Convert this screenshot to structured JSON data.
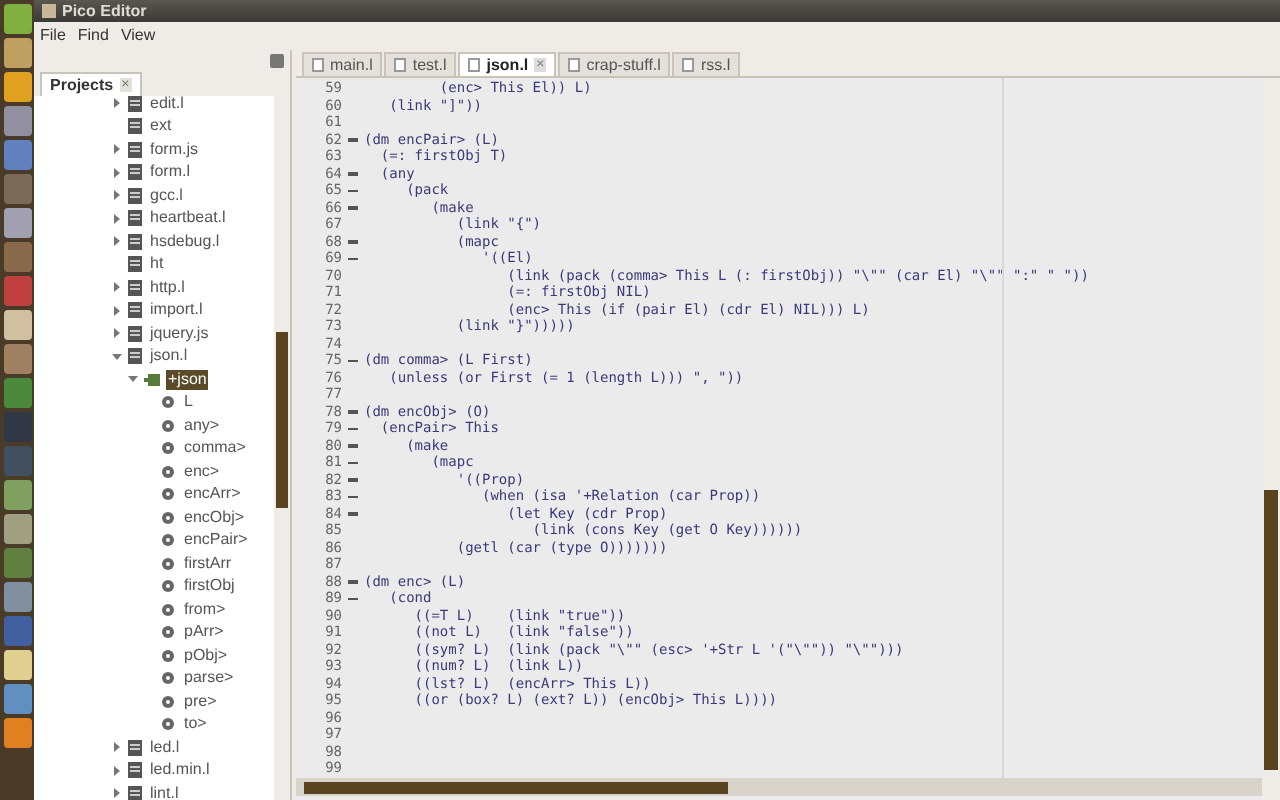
{
  "window": {
    "title": "Pico Editor"
  },
  "menu": [
    "File",
    "Find",
    "View"
  ],
  "panel": {
    "tab": "Projects",
    "tab_close": "×"
  },
  "tree": [
    {
      "label": "edit.l",
      "kind": "file",
      "expanded": false
    },
    {
      "label": "ext",
      "kind": "file"
    },
    {
      "label": "form.js",
      "kind": "file",
      "expanded": false
    },
    {
      "label": "form.l",
      "kind": "file",
      "expanded": false
    },
    {
      "label": "gcc.l",
      "kind": "file",
      "expanded": false
    },
    {
      "label": "heartbeat.l",
      "kind": "file",
      "expanded": false
    },
    {
      "label": "hsdebug.l",
      "kind": "file",
      "expanded": false
    },
    {
      "label": "ht",
      "kind": "file"
    },
    {
      "label": "http.l",
      "kind": "file",
      "expanded": false
    },
    {
      "label": "import.l",
      "kind": "file",
      "expanded": false
    },
    {
      "label": "jquery.js",
      "kind": "file",
      "expanded": false
    },
    {
      "label": "json.l",
      "kind": "file",
      "expanded": true,
      "children": [
        {
          "label": "+json",
          "kind": "class",
          "expanded": true,
          "selected": true,
          "children": [
            {
              "label": "L",
              "kind": "method"
            },
            {
              "label": "any>",
              "kind": "method"
            },
            {
              "label": "comma>",
              "kind": "method"
            },
            {
              "label": "enc>",
              "kind": "method"
            },
            {
              "label": "encArr>",
              "kind": "method"
            },
            {
              "label": "encObj>",
              "kind": "method"
            },
            {
              "label": "encPair>",
              "kind": "method"
            },
            {
              "label": "firstArr",
              "kind": "method"
            },
            {
              "label": "firstObj",
              "kind": "method"
            },
            {
              "label": "from>",
              "kind": "method"
            },
            {
              "label": "pArr>",
              "kind": "method"
            },
            {
              "label": "pObj>",
              "kind": "method"
            },
            {
              "label": "parse>",
              "kind": "method"
            },
            {
              "label": "pre>",
              "kind": "method"
            },
            {
              "label": "to>",
              "kind": "method"
            }
          ]
        }
      ]
    },
    {
      "label": "led.l",
      "kind": "file",
      "expanded": false
    },
    {
      "label": "led.min.l",
      "kind": "file",
      "expanded": false
    },
    {
      "label": "lint.l",
      "kind": "file",
      "expanded": false
    }
  ],
  "tabs": [
    {
      "label": "main.l",
      "selected": false
    },
    {
      "label": "test.l",
      "selected": false
    },
    {
      "label": "json.l",
      "selected": true,
      "close": "×"
    },
    {
      "label": "crap-stuff.l",
      "selected": false
    },
    {
      "label": "rss.l",
      "selected": false
    }
  ],
  "code": [
    {
      "n": "59",
      "fold": false,
      "text": "         (enc> This El)) L)"
    },
    {
      "n": "60",
      "fold": false,
      "text": "   (link \"]\"))"
    },
    {
      "n": "61",
      "fold": false
    },
    {
      "n": "62",
      "fold": true,
      "text": "(dm encPair> (L)"
    },
    {
      "n": "63",
      "fold": false,
      "text": "  (=: firstObj T)"
    },
    {
      "n": "64",
      "fold": true,
      "text": "  (any"
    },
    {
      "n": "65",
      "fold": true,
      "text": "     (pack"
    },
    {
      "n": "66",
      "fold": true,
      "text": "        (make"
    },
    {
      "n": "67",
      "fold": false,
      "text": "           (link \"{\")"
    },
    {
      "n": "68",
      "fold": true,
      "text": "           (mapc"
    },
    {
      "n": "69",
      "fold": true,
      "text": "              '((El)"
    },
    {
      "n": "70",
      "fold": false,
      "text": "                 (link (pack (comma> This L (: firstObj)) \"\\\"\" (car El) \"\\\"\" \":\" \" \"))"
    },
    {
      "n": "71",
      "fold": false,
      "text": "                 (=: firstObj NIL)"
    },
    {
      "n": "72",
      "fold": false,
      "text": "                 (enc> This (if (pair El) (cdr El) NIL))) L)"
    },
    {
      "n": "73",
      "fold": false,
      "text": "           (link \"}\")))))"
    },
    {
      "n": "74",
      "fold": false
    },
    {
      "n": "75",
      "fold": true,
      "text": "(dm comma> (L First)"
    },
    {
      "n": "76",
      "fold": false,
      "text": "   (unless (or First (= 1 (length L))) \", \"))"
    },
    {
      "n": "77",
      "fold": false
    },
    {
      "n": "78",
      "fold": true,
      "text": "(dm encObj> (O)"
    },
    {
      "n": "79",
      "fold": true,
      "text": "  (encPair> This"
    },
    {
      "n": "80",
      "fold": true,
      "text": "     (make"
    },
    {
      "n": "81",
      "fold": true,
      "text": "        (mapc"
    },
    {
      "n": "82",
      "fold": true,
      "text": "           '((Prop)"
    },
    {
      "n": "83",
      "fold": true,
      "text": "              (when (isa '+Relation (car Prop))"
    },
    {
      "n": "84",
      "fold": true,
      "text": "                 (let Key (cdr Prop)"
    },
    {
      "n": "85",
      "fold": false,
      "text": "                    (link (cons Key (get O Key))))))"
    },
    {
      "n": "86",
      "fold": false,
      "text": "           (getl (car (type O)))))))"
    },
    {
      "n": "87",
      "fold": false
    },
    {
      "n": "88",
      "fold": true,
      "text": "(dm enc> (L)"
    },
    {
      "n": "89",
      "fold": true,
      "text": "   (cond"
    },
    {
      "n": "90",
      "fold": false,
      "text": "      ((=T L)    (link \"true\"))"
    },
    {
      "n": "91",
      "fold": false,
      "text": "      ((not L)   (link \"false\"))"
    },
    {
      "n": "92",
      "fold": false,
      "text": "      ((sym? L)  (link (pack \"\\\"\" (esc> '+Str L '(\"\\\"\")) \"\\\"\")))"
    },
    {
      "n": "93",
      "fold": false,
      "text": "      ((num? L)  (link L))"
    },
    {
      "n": "94",
      "fold": false,
      "text": "      ((lst? L)  (encArr> This L))"
    },
    {
      "n": "95",
      "fold": false,
      "text": "      ((or (box? L) (ext? L)) (encObj> This L))))"
    },
    {
      "n": "96",
      "fold": false
    },
    {
      "n": "97",
      "fold": false
    },
    {
      "n": "98",
      "fold": false
    },
    {
      "n": "99",
      "fold": false
    }
  ]
}
